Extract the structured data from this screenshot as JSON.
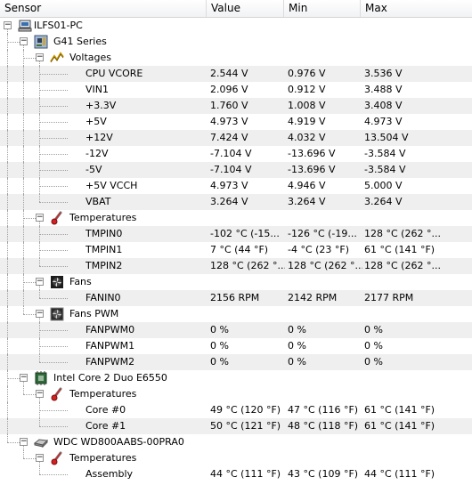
{
  "columns": {
    "sensor": "Sensor",
    "value": "Value",
    "min": "Min",
    "max": "Max"
  },
  "tree": [
    {
      "label": "ILFS01-PC",
      "level": 0,
      "icon": "computer-icon",
      "expander": "−"
    },
    {
      "label": "G41 Series",
      "level": 1,
      "icon": "motherboard-icon",
      "expander": "−"
    },
    {
      "label": "Voltages",
      "level": 2,
      "icon": "voltage-icon",
      "expander": "−"
    },
    {
      "label": "CPU VCORE",
      "level": 3,
      "value": "2.544 V",
      "min": "0.976 V",
      "max": "3.536 V"
    },
    {
      "label": "VIN1",
      "level": 3,
      "value": "2.096 V",
      "min": "0.912 V",
      "max": "3.488 V"
    },
    {
      "label": "+3.3V",
      "level": 3,
      "value": "1.760 V",
      "min": "1.008 V",
      "max": "3.408 V"
    },
    {
      "label": "+5V",
      "level": 3,
      "value": "4.973 V",
      "min": "4.919 V",
      "max": "4.973 V"
    },
    {
      "label": "+12V",
      "level": 3,
      "value": "7.424 V",
      "min": "4.032 V",
      "max": "13.504 V"
    },
    {
      "label": "-12V",
      "level": 3,
      "value": "-7.104 V",
      "min": "-13.696 V",
      "max": "-3.584 V"
    },
    {
      "label": "-5V",
      "level": 3,
      "value": "-7.104 V",
      "min": "-13.696 V",
      "max": "-3.584 V"
    },
    {
      "label": "+5V VCCH",
      "level": 3,
      "value": "4.973 V",
      "min": "4.946 V",
      "max": "5.000 V"
    },
    {
      "label": "VBAT",
      "level": 3,
      "value": "3.264 V",
      "min": "3.264 V",
      "max": "3.264 V"
    },
    {
      "label": "Temperatures",
      "level": 2,
      "icon": "thermometer-icon",
      "expander": "−"
    },
    {
      "label": "TMPIN0",
      "level": 3,
      "value": "-102 °C  (-15...",
      "min": "-126 °C  (-19...",
      "max": "128 °C  (262 °..."
    },
    {
      "label": "TMPIN1",
      "level": 3,
      "value": "7 °C  (44 °F)",
      "min": "-4 °C  (23 °F)",
      "max": "61 °C  (141 °F)"
    },
    {
      "label": "TMPIN2",
      "level": 3,
      "value": "128 °C  (262 °...",
      "min": "128 °C  (262 °...",
      "max": "128 °C  (262 °..."
    },
    {
      "label": "Fans",
      "level": 2,
      "icon": "fan-icon",
      "expander": "−"
    },
    {
      "label": "FANIN0",
      "level": 3,
      "value": "2156 RPM",
      "min": "2142 RPM",
      "max": "2177 RPM"
    },
    {
      "label": "Fans PWM",
      "level": 2,
      "icon": "fan-pwm-icon",
      "expander": "−"
    },
    {
      "label": "FANPWM0",
      "level": 3,
      "value": "0 %",
      "min": "0 %",
      "max": "0 %"
    },
    {
      "label": "FANPWM1",
      "level": 3,
      "value": "0 %",
      "min": "0 %",
      "max": "0 %"
    },
    {
      "label": "FANPWM2",
      "level": 3,
      "value": "0 %",
      "min": "0 %",
      "max": "0 %"
    },
    {
      "label": "Intel Core 2 Duo E6550",
      "level": 1,
      "icon": "cpu-icon",
      "expander": "−"
    },
    {
      "label": "Temperatures",
      "level": 2,
      "icon": "thermometer-icon",
      "expander": "−"
    },
    {
      "label": "Core #0",
      "level": 3,
      "value": "49 °C  (120 °F)",
      "min": "47 °C  (116 °F)",
      "max": "61 °C  (141 °F)"
    },
    {
      "label": "Core #1",
      "level": 3,
      "value": "50 °C  (121 °F)",
      "min": "48 °C  (118 °F)",
      "max": "61 °C  (141 °F)"
    },
    {
      "label": "WDC WD800AABS-00PRA0",
      "level": 1,
      "icon": "hard-drive-icon",
      "expander": "−"
    },
    {
      "label": "Temperatures",
      "level": 2,
      "icon": "thermometer-icon",
      "expander": "−"
    },
    {
      "label": "Assembly",
      "level": 3,
      "value": "44 °C  (111 °F)",
      "min": "43 °C  (109 °F)",
      "max": "44 °C  (111 °F)"
    }
  ]
}
